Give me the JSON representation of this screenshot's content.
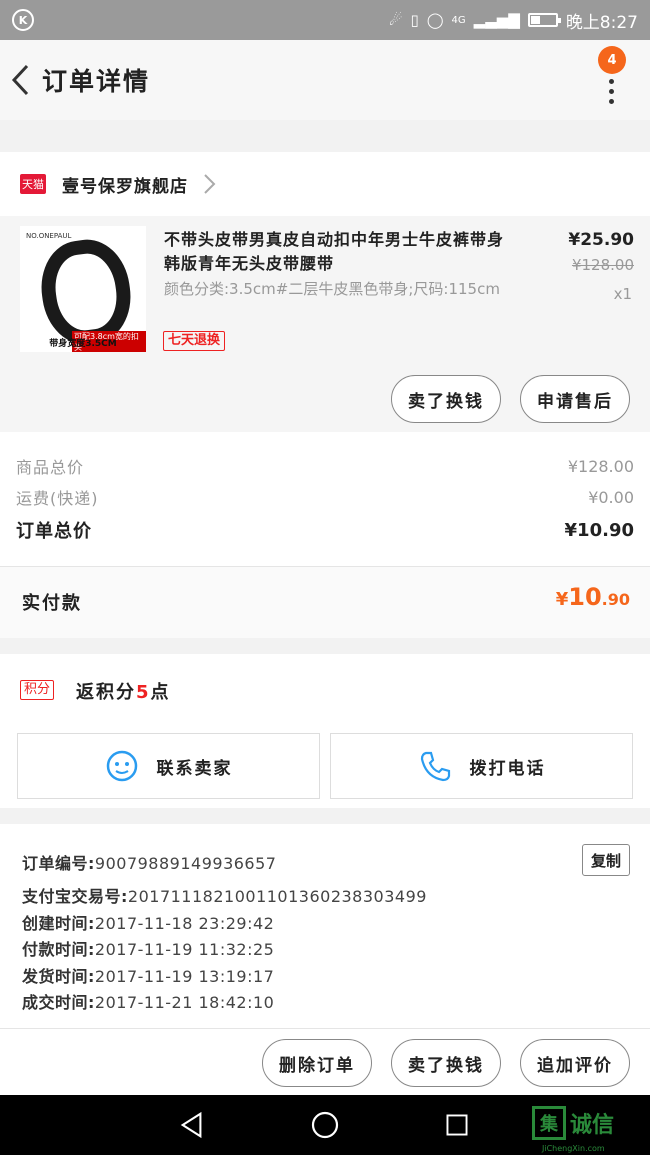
{
  "status_bar": {
    "app_glyph": "K",
    "network": "4G",
    "time": "晚上8:27",
    "icons": [
      "headset-icon",
      "vibrate-icon",
      "alarm-icon",
      "signal-icon",
      "battery-icon"
    ]
  },
  "header": {
    "title": "订单详情",
    "badge_count": "4"
  },
  "shop": {
    "logo_text": "天猫",
    "name": "壹号保罗旗舰店"
  },
  "product": {
    "image_brand": "NO.ONEPAUL",
    "image_tag": "可配3.8cm宽的扣头",
    "image_caption": "带身宽度3.5CM",
    "title": "不带头皮带男真皮自动扣中年男士牛皮裤带身韩版青年无头皮带腰带",
    "spec": "颜色分类:3.5cm#二层牛皮黑色带身;尺码:115cm",
    "badge": "七天退换",
    "price": "¥25.90",
    "original_price": "¥128.00",
    "quantity": "x1",
    "buttons": [
      "卖了换钱",
      "申请售后"
    ]
  },
  "totals": {
    "rows": [
      {
        "label": "商品总价",
        "value": "¥128.00"
      },
      {
        "label": "运费(快递)",
        "value": "¥0.00"
      },
      {
        "label": "订单总价",
        "value": "¥10.90"
      }
    ]
  },
  "paid": {
    "label": "实付款",
    "currency": "¥",
    "integer": "10",
    "decimal": ".90"
  },
  "points": {
    "badge": "积分",
    "prefix": "返积分",
    "amount": "5",
    "suffix": "点",
    "contact_seller": "联系卖家",
    "call_phone": "拨打电话"
  },
  "order_info": {
    "copy_label": "复制",
    "rows": [
      {
        "key": "订单编号:",
        "value": "90079889149936657"
      },
      {
        "key": "支付宝交易号:",
        "value": "2017111821001101360238303499"
      },
      {
        "key": "创建时间:",
        "value": "2017-11-18 23:29:42"
      },
      {
        "key": "付款时间:",
        "value": "2017-11-19 11:32:25"
      },
      {
        "key": "发货时间:",
        "value": "2017-11-19 13:19:17"
      },
      {
        "key": "成交时间:",
        "value": "2017-11-21 18:42:10"
      }
    ]
  },
  "bottom_actions": [
    "删除订单",
    "卖了换钱",
    "追加评价"
  ],
  "watermark": {
    "box_char": "集",
    "text": "诚信",
    "url": "JiChengXin.com"
  }
}
